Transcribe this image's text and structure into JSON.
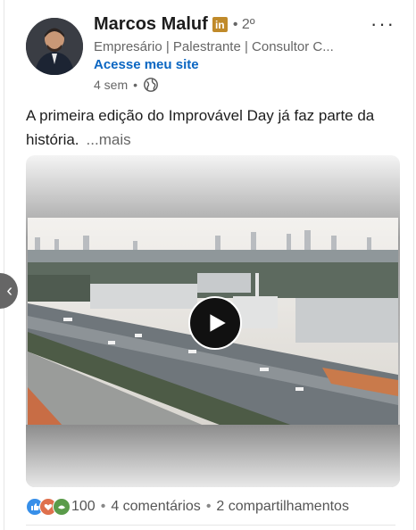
{
  "post": {
    "author": {
      "name": "Marcos Maluf",
      "badge": "in",
      "degree": "• 2º",
      "headline": "Empresário | Palestrante | Consultor C...",
      "site_link": "Acesse meu site"
    },
    "meta": {
      "time": "4 sem",
      "separator": "•",
      "visibility_icon": "globe-icon"
    },
    "menu_label": "···",
    "text": "A primeira edição do Improvável Day já faz parte da história.",
    "more_label": "...mais",
    "video": {
      "play_icon": "play-icon"
    },
    "social": {
      "reaction_icons": [
        "like-icon",
        "love-icon",
        "support-icon"
      ],
      "reactions_count": "100",
      "comments": "4 comentários",
      "shares": "2 compartilhamentos",
      "separator": "•"
    }
  },
  "nav": {
    "prev_icon": "chevron-left-icon",
    "prev_label": "‹"
  },
  "colors": {
    "link": "#0a66c2",
    "badge": "#c08a2a",
    "like": "#378fe9",
    "love": "#df704d",
    "support": "#5a9b4a"
  }
}
